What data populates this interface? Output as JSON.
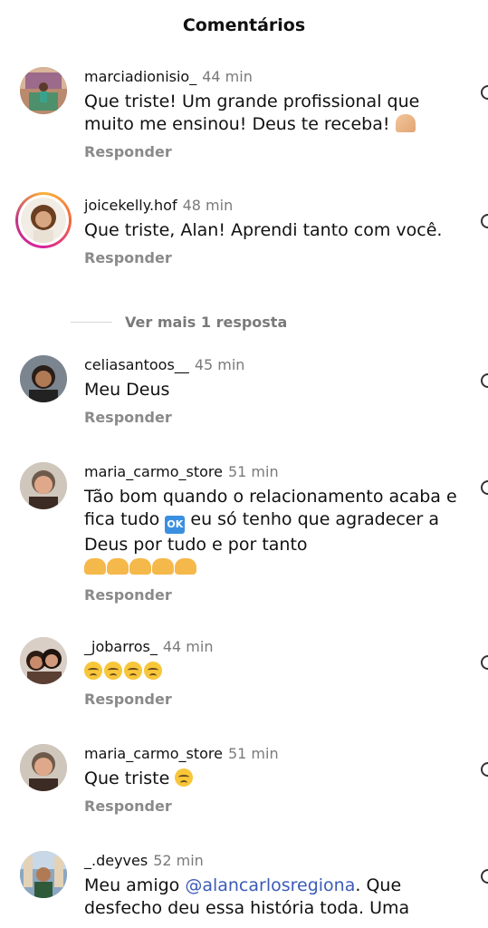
{
  "header": {
    "title": "Comentários"
  },
  "reply_label": "Responder",
  "view_more": "Ver mais 1 resposta",
  "comments": [
    {
      "username": "marciadionisio_",
      "time": "44 min",
      "text": "Que triste! Um grande profissional que muito me ensinou! Deus te receba!",
      "emoji": "folded-hands"
    },
    {
      "username": "joicekelly.hof",
      "time": "48 min",
      "text": "Que triste, Alan! Aprendi tanto com você."
    },
    {
      "username": "celiasantoos__",
      "time": "45 min",
      "text": "Meu Deus"
    },
    {
      "username": "maria_carmo_store",
      "time": "51 min",
      "text_part1": "Tão bom quando o relacionamento acaba e fica tudo",
      "ok_label": "OK",
      "text_part2": "eu só tenho que agradecer a Deus por tudo e por tanto",
      "emoji": "raising-hands x5"
    },
    {
      "username": "_jobarros_",
      "time": "44 min",
      "emoji": "crying-face x4"
    },
    {
      "username": "maria_carmo_store",
      "time": "51 min",
      "text": "Que triste",
      "emoji": "crying-face"
    },
    {
      "username": "_.deyves",
      "time": "52 min",
      "text_part1": "Meu amigo",
      "mention": "@alancarlosregiona",
      "text_part2": ". Que desfecho deu essa história toda. Uma"
    }
  ],
  "colors": {
    "mention": "#3b5bb7",
    "secondary_text": "#7a7a7a",
    "story_ring": "#d6249f"
  }
}
